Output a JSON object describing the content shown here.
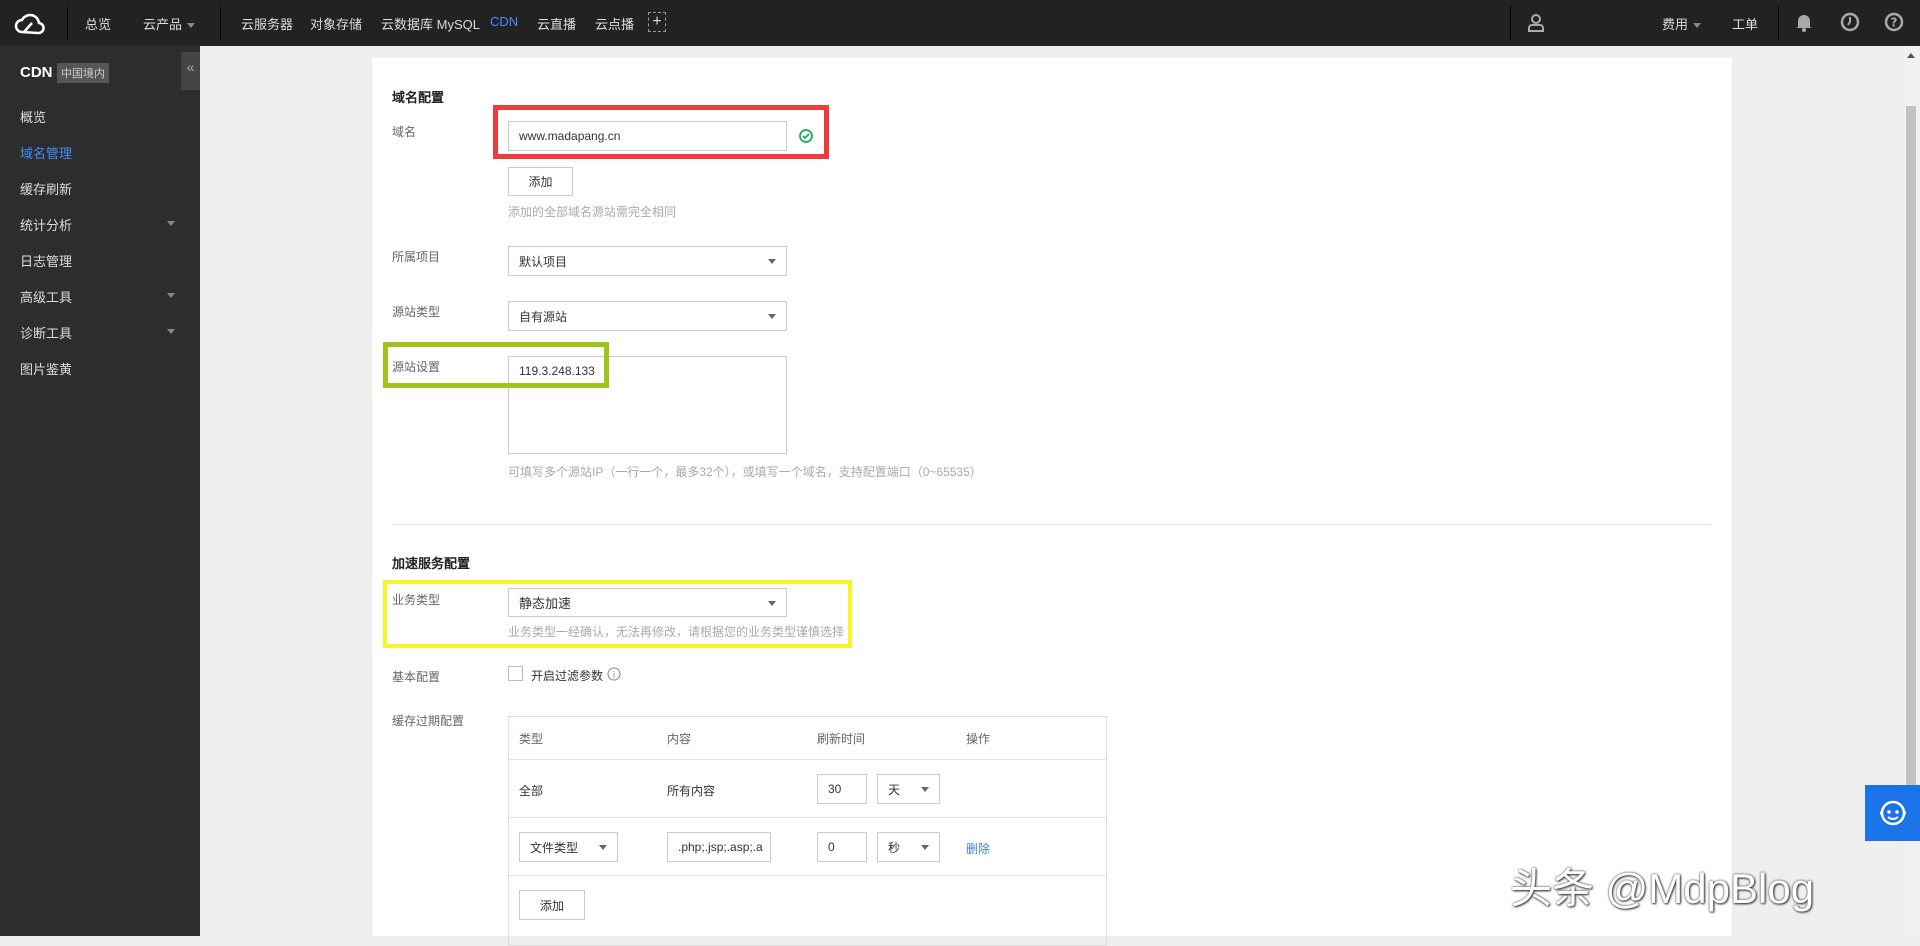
{
  "topbar": {
    "home": "总览",
    "products": "云产品",
    "shortcuts": [
      "云服务器",
      "对象存储",
      "云数据库 MySQL",
      "CDN",
      "云直播",
      "云点播"
    ],
    "add": "+",
    "fees": "费用",
    "ticket": "工单"
  },
  "sidebar": {
    "title": "CDN",
    "region": "中国境内",
    "collapse": "«",
    "items": [
      {
        "label": "概览"
      },
      {
        "label": "域名管理"
      },
      {
        "label": "缓存刷新"
      },
      {
        "label": "统计分析"
      },
      {
        "label": "日志管理"
      },
      {
        "label": "高级工具"
      },
      {
        "label": "诊断工具"
      },
      {
        "label": "图片鉴黄"
      }
    ]
  },
  "domain_config": {
    "heading": "域名配置",
    "domain_label": "域名",
    "domain_value": "www.madapang.cn",
    "add_button": "添加",
    "add_hint": "添加的全部域名源站需完全相同",
    "project_label": "所属项目",
    "project_value": "默认项目",
    "origin_type_label": "源站类型",
    "origin_type_value": "自有源站",
    "origin_label": "源站设置",
    "origin_value": "119.3.248.133",
    "origin_hint": "可填写多个源站IP（一行一个，最多32个），或填写一个域名，支持配置端口（0~65535）"
  },
  "service_config": {
    "heading": "加速服务配置",
    "biz_label": "业务类型",
    "biz_value": "静态加速",
    "biz_hint": "业务类型一经确认，无法再修改，请根据您的业务类型谨慎选择",
    "basic_label": "基本配置",
    "filter_label": "开启过滤参数",
    "cache_label": "缓存过期配置",
    "cache_table": {
      "headers": [
        "类型",
        "内容",
        "刷新时间",
        "操作"
      ],
      "rows": [
        {
          "type": "全部",
          "content": "所有内容",
          "time": "30",
          "unit": "天",
          "action": ""
        },
        {
          "type": "文件类型",
          "content": ".php;.jsp;.asp;.a",
          "time": "0",
          "unit": "秒",
          "action": "删除"
        }
      ],
      "add_button": "添加"
    }
  },
  "watermark": "头条 @MdpBlog",
  "colors": {
    "accent": "#3f8fff",
    "red_box": "#ee3b3b",
    "green_box": "#9dc51a",
    "yellow_box": "#f5f52a",
    "success": "#1aad5c"
  }
}
